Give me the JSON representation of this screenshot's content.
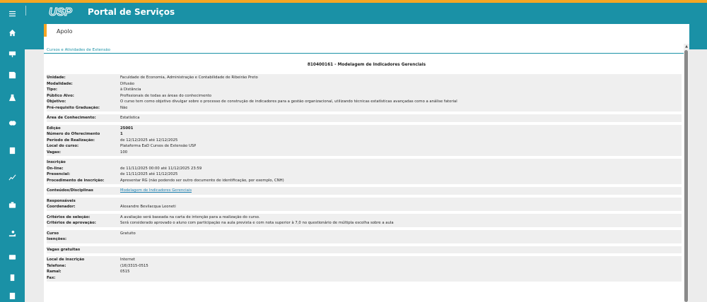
{
  "header": {
    "logo_text": "USP",
    "title": "Portal de Serviços"
  },
  "sidebar": {
    "icons": [
      "home-icon",
      "presentation-icon",
      "save-icon",
      "flask-icon",
      "masks-icon",
      "book-icon",
      "chart-icon",
      "briefcase-icon",
      "hand-coin-icon",
      "card-icon",
      "building-icon",
      "document-icon"
    ]
  },
  "breadcrumb": {
    "label": "Apolo"
  },
  "section": {
    "label": "Cursos e Atividades de Extensão"
  },
  "course": {
    "title": "810400161 - Modelagem de Indicadores Gerenciais"
  },
  "groups": [
    {
      "rows": [
        {
          "label": "Unidade:",
          "value": "Faculdade de Economia, Administração e Contabilidade de Ribeirão Preto"
        },
        {
          "label": "Modalidade:",
          "value": "Difusão"
        },
        {
          "label": "Tipo:",
          "value": "à Distância"
        },
        {
          "label": "Público Alvo:",
          "value": "Profissionais de todas as áreas do conhecimento"
        },
        {
          "label": "Objetivo:",
          "value": "O curso tem como objetivo divulgar sobre o processo de construção de indicadores para a gestão organizacional, utilizando técnicas estatísticas avançadas como a análise fatorial"
        },
        {
          "label": "Pré-requisito Graduação:",
          "value": "Não"
        }
      ]
    },
    {
      "rows": [
        {
          "label": "Área de Conhecimento:",
          "value": "Estatística"
        }
      ]
    },
    {
      "rows": [
        {
          "label": "Edição",
          "value": "25001",
          "bold": true
        },
        {
          "label": "Número do Oferecimento",
          "value": "1",
          "bold": true
        },
        {
          "label": "Período de Realização:",
          "value": "de 12/12/2025 até 12/12/2025"
        },
        {
          "label": "Local do curso:",
          "value": "Plataforma EaD Cursos de Extensão USP"
        },
        {
          "label": "Vagas:",
          "value": "100"
        }
      ]
    },
    {
      "rows": [
        {
          "label": "Inscrição",
          "value": ""
        },
        {
          "label": "On-line:",
          "value": "de 11/11/2025 00:00 até 11/12/2025 23:59"
        },
        {
          "label": "Presencial:",
          "value": "de 11/11/2025 até 11/12/2025"
        },
        {
          "label": "Procedimento de inscrição:",
          "value": "Apresentar RG (não podendo ser outro documento de identificação, por exemplo, CNH)"
        }
      ]
    },
    {
      "rows": [
        {
          "label": "Conteúdos/Disciplinas",
          "value": "Modelagem de Indicadores Gerenciais",
          "link": true
        }
      ]
    },
    {
      "rows": [
        {
          "label": "Responsáveis",
          "value": ""
        },
        {
          "label": "Coordenador:",
          "value": "Alexandre Bevilacqua Leoneti"
        }
      ]
    },
    {
      "rows": [
        {
          "label": "Critérios de seleção:",
          "value": "A avaliação será baseada na carta de intenção para a realização do curso."
        },
        {
          "label": "Critérios de aprovação:",
          "value": "Será considerado aprovado o aluno com participação na aula prevista e com nota superior à 7,0 no questionário de múltipla escolha sobre a aula"
        }
      ]
    },
    {
      "rows": [
        {
          "label": "Curso",
          "value": "Gratuito"
        },
        {
          "label": "Isenções:",
          "value": ""
        }
      ]
    },
    {
      "rows": [
        {
          "label": "Vagas gratuitas",
          "value": ""
        }
      ]
    },
    {
      "rows": [
        {
          "label": "Local de inscrição",
          "value": "Internet"
        },
        {
          "label": "Telefone:",
          "value": "(16)3315-0515"
        },
        {
          "label": "Ramal:",
          "value": "0515"
        },
        {
          "label": "Fax:",
          "value": ""
        }
      ]
    }
  ],
  "colors": {
    "accent": "#1a91a6",
    "highlight": "#f5a623"
  }
}
